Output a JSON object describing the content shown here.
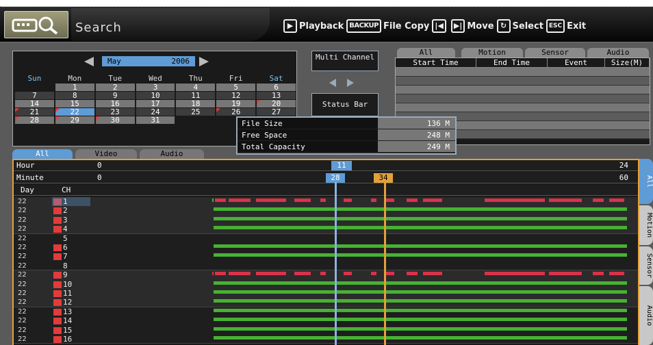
{
  "app": {
    "title": "Search"
  },
  "help": [
    {
      "key": "▶",
      "label": "Playback",
      "cls": ""
    },
    {
      "key": "BACKUP",
      "label": "File Copy",
      "cls": "backup"
    },
    {
      "key": "|◀",
      "label": "",
      "cls": ""
    },
    {
      "key": "▶|",
      "label": "Move",
      "cls": ""
    },
    {
      "key": "↻",
      "label": "Select",
      "cls": ""
    },
    {
      "key": "ESC",
      "label": "Exit",
      "cls": "esc"
    }
  ],
  "calendar": {
    "month": "May",
    "year": "2006",
    "weekdays": [
      "Sun",
      "Mon",
      "Tue",
      "Wed",
      "Thu",
      "Fri",
      "Sat"
    ],
    "weeks": [
      [
        "",
        "1",
        "2",
        "3",
        "4",
        "5",
        "6"
      ],
      [
        "7",
        "8",
        "9",
        "10",
        "11",
        "12",
        "13"
      ],
      [
        "14",
        "15",
        "16",
        "17",
        "18",
        "19",
        "20"
      ],
      [
        "21",
        "22",
        "23",
        "24",
        "25",
        "26",
        "27"
      ],
      [
        "28",
        "29",
        "30",
        "31",
        "",
        "",
        ""
      ]
    ],
    "selected": "22",
    "recorded": [
      "20",
      "21",
      "22",
      "26",
      "28",
      "29",
      "30"
    ]
  },
  "buttons": {
    "multi_channel": "Multi Channel",
    "status_bar": "Status Bar"
  },
  "event_list": {
    "tabs": [
      "All",
      "Motion",
      "Sensor",
      "Audio"
    ],
    "columns": [
      "Start Time",
      "End Time",
      "Event",
      "Size(M)"
    ],
    "rows": 8
  },
  "popup": {
    "rows": [
      {
        "label": "File Size",
        "value": "136 M"
      },
      {
        "label": "Free Space",
        "value": "248 M"
      },
      {
        "label": "Total Capacity",
        "value": "249 M"
      }
    ]
  },
  "timeline": {
    "tabs": [
      "All",
      "Video",
      "Audio"
    ],
    "hour": {
      "label": "Hour",
      "start": "0",
      "end": "24",
      "marker": "11"
    },
    "minute": {
      "label": "Minute",
      "start": "0",
      "end": "60",
      "marker_blue": "28",
      "marker_orange": "34"
    },
    "headers": {
      "day": "Day",
      "ch": "CH"
    },
    "day": "22",
    "channels": [
      "1",
      "2",
      "3",
      "4",
      "5",
      "6",
      "7",
      "8",
      "9",
      "10",
      "11",
      "12",
      "13",
      "14",
      "15",
      "16"
    ],
    "side_tabs": [
      "All",
      "Motion",
      "Sensor",
      "Audio"
    ]
  },
  "colors": {
    "accent": "#5f9bd5",
    "record_red": "#d8334a",
    "record_green": "#47b232",
    "marker_orange": "#e2a13a"
  }
}
